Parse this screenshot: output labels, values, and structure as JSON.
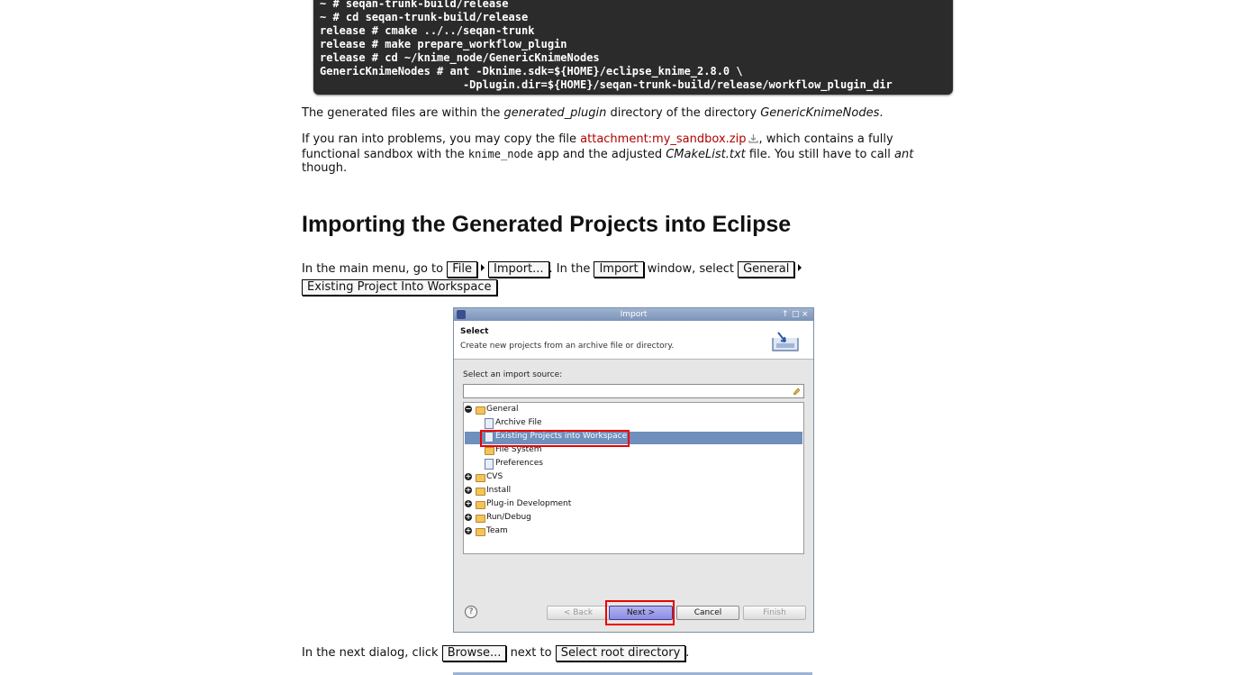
{
  "code_block": {
    "lines": [
      "~ # seqan-trunk-build/release",
      "~ # cd seqan-trunk-build/release",
      "release # cmake ../../seqan-trunk",
      "release # make prepare_workflow_plugin",
      "release # cd ~/knime_node/GenericKnimeNodes",
      "GenericKnimeNodes # ant -Dknime.sdk=${HOME}/eclipse_knime_2.8.0 \\",
      "                      -Dplugin.dir=${HOME}/seqan-trunk-build/release/workflow_plugin_dir"
    ]
  },
  "para1": {
    "t1": "The generated files are within the ",
    "em1": "generated_plugin",
    "t2": " directory of the directory ",
    "em2": "GenericKnimeNodes",
    "t3": "."
  },
  "para2": {
    "t1": "If you ran into problems, you may copy the file ",
    "link": "attachment:my_sandbox.zip",
    "t2": ", which contains a fully",
    "t3": "functional sandbox with the ",
    "code": "knime_node",
    "t4": " app and the adjusted ",
    "em1": "CMakeList.txt",
    "t5": " file. You still have to call ",
    "em2": "ant",
    "t6": "though."
  },
  "heading": "Importing the Generated Projects into Eclipse",
  "para3": {
    "t1": "In the main menu, go to ",
    "k1": "File",
    "k2": "Import...",
    "t2": ". In the ",
    "k3": "Import",
    "t3": " window, select ",
    "k4": "General",
    "k5": "Existing Project Into Workspace"
  },
  "dialog": {
    "title": "Import",
    "window_buttons": [
      "↑",
      "□",
      "×"
    ],
    "header_title": "Select",
    "header_desc": "Create new projects from an archive file or directory.",
    "source_label": "Select an import source:",
    "filter_value": "",
    "tree": [
      {
        "label": "General",
        "expanded": true
      },
      {
        "label": "Archive File"
      },
      {
        "label": "Existing Projects into Workspace",
        "selected": true
      },
      {
        "label": "File System"
      },
      {
        "label": "Preferences"
      },
      {
        "label": "CVS"
      },
      {
        "label": "Install"
      },
      {
        "label": "Plug-in Development"
      },
      {
        "label": "Run/Debug"
      },
      {
        "label": "Team"
      }
    ],
    "help": "?",
    "buttons": {
      "back": "< Back",
      "next": "Next >",
      "cancel": "Cancel",
      "finish": "Finish"
    }
  },
  "para4": {
    "t1": "In the next dialog, click ",
    "k1": "Browse...",
    "t2": " next to ",
    "k2": "Select root directory",
    "t3": "."
  },
  "colors": {
    "code_bg": "#2b2b2b",
    "link": "#b00000",
    "highlight": "#e00000",
    "selection": "#6f8fbd"
  }
}
